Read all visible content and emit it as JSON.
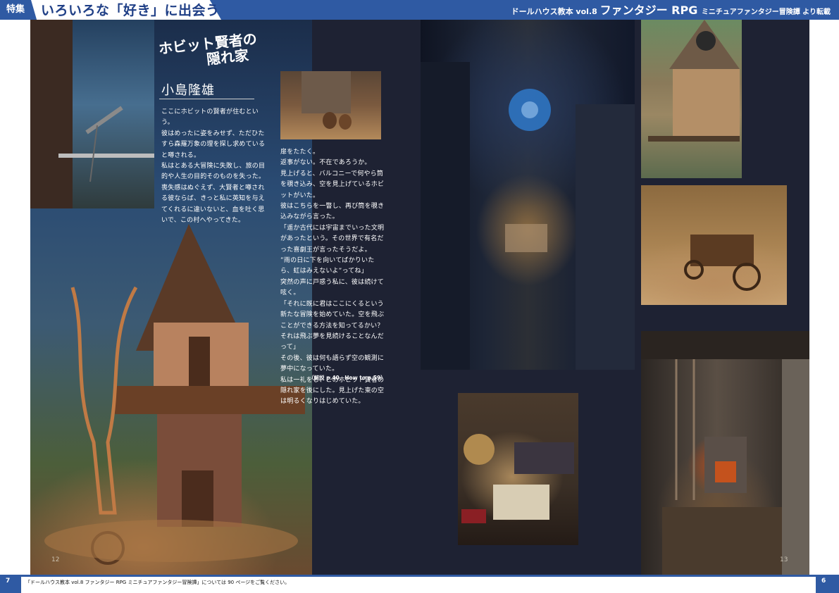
{
  "header": {
    "tag": "特集",
    "feature_title": "いろいろな「好き」に出会う",
    "source_1": "ドールハウス教本 vol.8 ",
    "source_2": "ファンタジー RPG ",
    "source_3": "ミニチュアファンタジー冒険譚 より転載"
  },
  "article": {
    "headline_1": "ホビット賢者の",
    "headline_2": "隠れ家",
    "author": "小島隆雄",
    "column_1": [
      "ここにホビットの賢者が住むという。",
      "彼はめったに姿をみせず、ただひたすら森羅万象の理を探し求めていると噂される。",
      "私はとある大冒険に失敗し、旅の目的や人生の目的そのものを失った。",
      "喪失感はぬぐえず、大賢者と噂される彼ならば、きっと私に英知を与えてくれるに違いないと、血を吐く思いで、この村へやってきた。"
    ],
    "column_2": [
      "扉をたたく。",
      "返事がない。不在であろうか。",
      "見上げると、バルコニーで何やら筒を覗き込み、空を見上げているホビットがいた。",
      "彼はこちらを一瞥し、再び筒を覗き込みながら言った。",
      "「遥か古代には宇宙までいった文明があったという。その世界で有名だった喜劇王が言ったそうだよ。",
      "”雨の日に下を向いてばかりいたら、虹はみえないよ”ってね」",
      "突然の声に戸惑う私に、彼は続けて呟く。",
      "「それに既に君はここにくるという新たな冒険を始めていた。空を飛ぶことができる方法を知ってるかい？それは飛ぶ夢を見続けることなんだって」",
      "その後、彼は何も語らず空の観測に夢中になっていた。",
      "私は一礼をし、このホビット賢者の隠れ家を後にした。見上げた東の空は明るくなりはじめていた。"
    ],
    "reference": "（解説 p.40、How to p.59）"
  },
  "photos": {
    "house_no": "12",
    "cellar_no": "13"
  },
  "footer": {
    "page_left": "7",
    "page_right": "6",
    "note": "「ドールハウス教本 vol.8 ファンタジー RPG ミニチュアファンタジー冒険譚」については 90 ページをご覧ください。"
  }
}
